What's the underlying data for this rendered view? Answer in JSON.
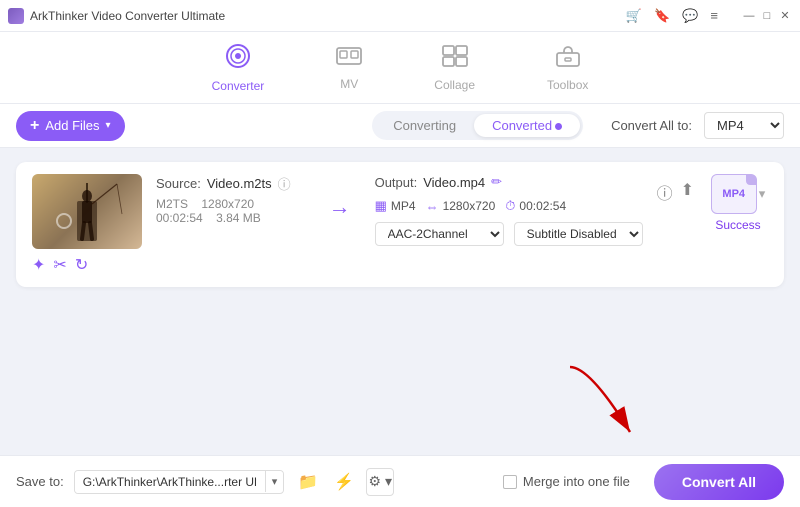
{
  "titleBar": {
    "appName": "ArkThinker Video Converter Ultimate",
    "icons": [
      "cart",
      "bookmark",
      "chat",
      "menu"
    ],
    "windowControls": [
      "minimize",
      "maximize",
      "close"
    ]
  },
  "nav": {
    "items": [
      {
        "id": "converter",
        "label": "Converter",
        "active": true
      },
      {
        "id": "mv",
        "label": "MV",
        "active": false
      },
      {
        "id": "collage",
        "label": "Collage",
        "active": false
      },
      {
        "id": "toolbox",
        "label": "Toolbox",
        "active": false
      }
    ]
  },
  "toolbar": {
    "addFiles": "Add Files",
    "tabs": [
      {
        "id": "converting",
        "label": "Converting",
        "active": false,
        "dot": false
      },
      {
        "id": "converted",
        "label": "Converted",
        "active": true,
        "dot": true
      }
    ],
    "convertAllTo": "Convert All to:",
    "format": "MP4"
  },
  "fileCard": {
    "sourceLabel": "Source:",
    "sourceName": "Video.m2ts",
    "outputLabel": "Output:",
    "outputName": "Video.mp4",
    "format": "M2TS",
    "resolution": "1280x720",
    "duration": "00:02:54",
    "fileSize": "3.84 MB",
    "outputFormat": "MP4",
    "outputResolution": "1280x720",
    "outputDuration": "00:02:54",
    "audioChannel": "AAC-2Channel",
    "subtitleOption": "Subtitle Disabled",
    "status": "Success"
  },
  "bottomBar": {
    "saveToLabel": "Save to:",
    "savePath": "G:\\ArkThinker\\ArkThinke...rter Ultimate\\Converted",
    "mergeLabel": "Merge into one file",
    "convertAllLabel": "Convert All"
  },
  "icons": {
    "plus": "+",
    "chevronDown": "▾",
    "arrowRight": "→",
    "info": "ⓘ",
    "edit": "✏",
    "sparkle": "✦",
    "cut": "✂",
    "rotate": "↻",
    "videoIcon": "▶",
    "audioIcon": "♪",
    "clockIcon": "⏱",
    "resizeIcon": "⇔",
    "folderIcon": "📁",
    "flashIcon": "⚡",
    "gearIcon": "⚙",
    "chevronGear": "▾",
    "cart": "🛒",
    "bookmark": "🔖",
    "chat": "💬",
    "menu": "≡",
    "minimize": "—",
    "maximize": "□",
    "close": "✕"
  }
}
